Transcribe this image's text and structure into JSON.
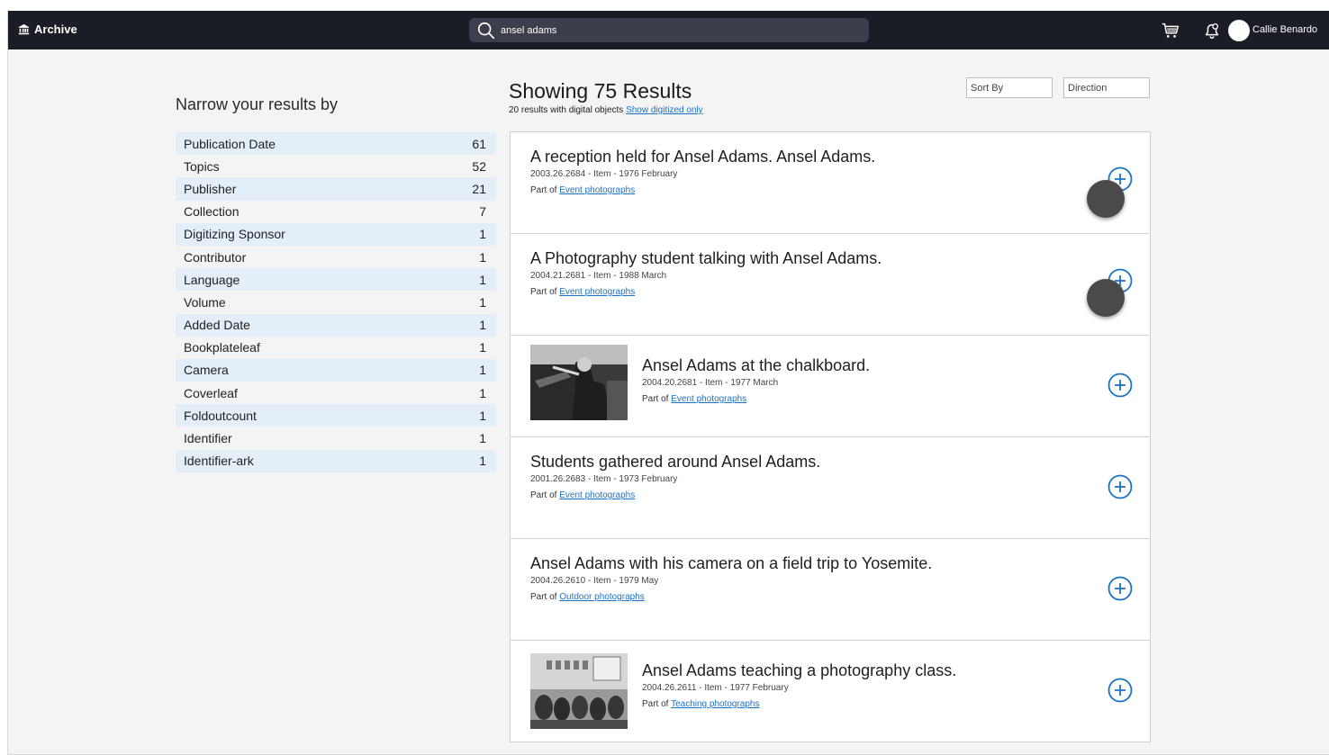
{
  "app": {
    "brand": "Archive"
  },
  "search": {
    "value": "ansel adams",
    "placeholder": ""
  },
  "user": {
    "name": "Callie Benardo"
  },
  "facets": {
    "title": "Narrow your results by",
    "items": [
      {
        "label": "Publication Date",
        "count": "61"
      },
      {
        "label": "Topics",
        "count": "52"
      },
      {
        "label": "Publisher",
        "count": "21"
      },
      {
        "label": "Collection",
        "count": "7"
      },
      {
        "label": "Digitizing Sponsor",
        "count": "1"
      },
      {
        "label": "Contributor",
        "count": "1"
      },
      {
        "label": "Language",
        "count": "1"
      },
      {
        "label": "Volume",
        "count": "1"
      },
      {
        "label": "Added Date",
        "count": "1"
      },
      {
        "label": "Bookplateleaf",
        "count": "1"
      },
      {
        "label": "Camera",
        "count": "1"
      },
      {
        "label": "Coverleaf",
        "count": "1"
      },
      {
        "label": "Foldoutcount",
        "count": "1"
      },
      {
        "label": "Identifier",
        "count": "1"
      },
      {
        "label": "Identifier-ark",
        "count": "1"
      }
    ]
  },
  "results": {
    "heading": "Showing 75 Results",
    "digital_note": "20 results with digital objects",
    "digitized_link": "Show digitized only",
    "sort_by": "Sort By",
    "direction": "Direction",
    "part_of": "Part of",
    "items": [
      {
        "title": "A reception held for Ansel Adams. Ansel Adams.",
        "meta": "2003.26.2684 - Item - 1976 February",
        "collection": "Event photographs"
      },
      {
        "title": "A Photography student talking with Ansel Adams.",
        "meta": "2004.21.2681 - Item - 1988 March",
        "collection": "Event photographs"
      },
      {
        "title": "Ansel Adams at the chalkboard.",
        "meta": "2004.20.2681 - Item - 1977 March",
        "collection": "Event photographs"
      },
      {
        "title": "Students gathered around Ansel Adams.",
        "meta": "2001.26.2683 - Item - 1973 February",
        "collection": "Event photographs"
      },
      {
        "title": "Ansel Adams with his camera on a field trip to Yosemite.",
        "meta": "2004.26.2610 - Item - 1979 May",
        "collection": "Outdoor photographs"
      },
      {
        "title": "Ansel Adams teaching a photography class.",
        "meta": "2004.26.2611 - Item - 1977 February",
        "collection": "Teaching photographs"
      }
    ]
  },
  "colors": {
    "navbar": "#1b1d26",
    "accent": "#1a73c9",
    "facet_stripe": "#e4eef9"
  }
}
